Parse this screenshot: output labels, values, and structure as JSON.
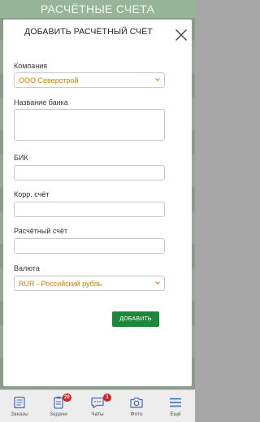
{
  "screen": {
    "title": "РАСЧЁТНЫЕ СЧЕТА"
  },
  "modal": {
    "title": "ДОБАВИТЬ РАСЧЁТНЫЙ СЧЁТ",
    "close_icon": "close-icon",
    "fields": {
      "company": {
        "label": "Компания",
        "value": "ООО Северстрой"
      },
      "bank_name": {
        "label": "Название банка",
        "value": ""
      },
      "bik": {
        "label": "БИК",
        "value": ""
      },
      "corr_account": {
        "label": "Корр. счёт",
        "value": ""
      },
      "settlement_account": {
        "label": "Расчётный счёт",
        "value": ""
      },
      "currency": {
        "label": "Валюта",
        "value": "RUR - Российский рубль"
      }
    },
    "submit_label": "ДОБАВИТЬ"
  },
  "tabbar": {
    "items": [
      {
        "label": "Заказы",
        "icon": "orders-icon"
      },
      {
        "label": "Задачи",
        "icon": "tasks-icon",
        "badge": "20"
      },
      {
        "label": "Чаты",
        "icon": "chat-icon",
        "badge": "1"
      },
      {
        "label": "Фото",
        "icon": "camera-icon"
      },
      {
        "label": "Ещё",
        "icon": "menu-icon"
      }
    ]
  },
  "colors": {
    "accent_green": "#1a8a3a",
    "select_text": "#e07b00",
    "badge": "#d92020",
    "tab_icon": "#3a6fc4"
  }
}
